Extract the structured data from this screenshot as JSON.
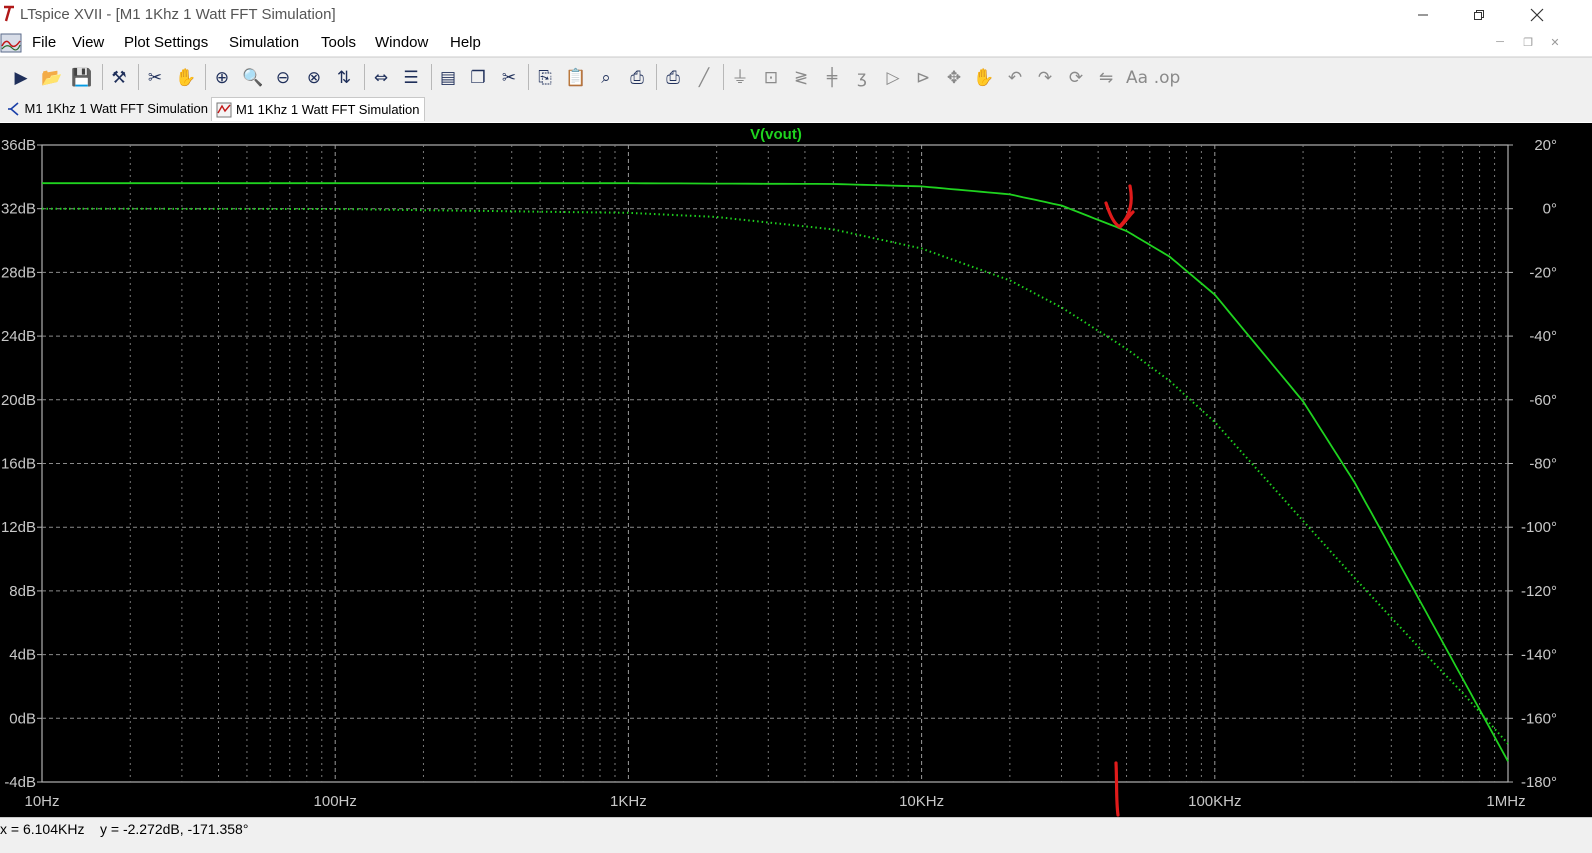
{
  "window": {
    "title": "LTspice XVII - [M1 1Khz 1 Watt FFT Simulation]",
    "icons": [
      "ltspice-app-icon",
      "minimize-icon",
      "maximize-icon",
      "close-icon"
    ]
  },
  "menu": {
    "items": [
      "File",
      "View",
      "Plot Settings",
      "Simulation",
      "Tools",
      "Window",
      "Help"
    ]
  },
  "toolbar": {
    "buttons": [
      "run",
      "open",
      "save",
      "control-panel",
      "run-halt",
      "pan",
      "zoom-area",
      "zoom-in",
      "zoom-out",
      "zoom-cancel",
      "autorange",
      "manual-limits",
      "tile-horizontal",
      "tile-vertical",
      "cascade",
      "cut",
      "copy",
      "paste",
      "find",
      "print-setup",
      "print",
      "wire",
      "ground",
      "label-net",
      "resistor",
      "capacitor",
      "inductor",
      "diode",
      "component",
      "move",
      "drag",
      "undo",
      "redo",
      "rotate",
      "mirror",
      "text",
      "spice-directive"
    ]
  },
  "tabs": [
    {
      "label": "M1 1Khz 1 Watt FFT Simulation",
      "icon": "schematic-icon",
      "active": false
    },
    {
      "label": "M1 1Khz 1 Watt FFT Simulation",
      "icon": "waveform-icon",
      "active": true
    }
  ],
  "chart_data": {
    "type": "line",
    "title": "V(vout)",
    "x_scale": "log",
    "x_range": [
      10,
      1000000
    ],
    "x_tick_labels": [
      "10Hz",
      "100Hz",
      "1KHz",
      "10KHz",
      "100KHz",
      "1MHz"
    ],
    "y_left_range": [
      -4,
      36
    ],
    "y_left_tick_labels": [
      "36dB",
      "32dB",
      "28dB",
      "24dB",
      "20dB",
      "16dB",
      "12dB",
      "8dB",
      "4dB",
      "0dB",
      "-4dB"
    ],
    "y_right_range": [
      -180,
      20
    ],
    "y_right_tick_labels": [
      "20°",
      "0°",
      "-20°",
      "-40°",
      "-60°",
      "-80°",
      "-100°",
      "-120°",
      "-140°",
      "-160°",
      "-180°"
    ],
    "grid": true,
    "background": "#000000",
    "trace_color": "#1fd31f",
    "annotation_color": "#e01b1b",
    "series": [
      {
        "axis": "left",
        "style": "solid",
        "x": [
          10,
          100,
          1000,
          5000,
          10000,
          20000,
          30000,
          50000,
          70000,
          100000,
          200000,
          300000,
          500000,
          700000,
          1000000
        ],
        "y": [
          33.6,
          33.6,
          33.6,
          33.55,
          33.4,
          32.9,
          32.2,
          30.6,
          29.0,
          26.6,
          19.9,
          14.8,
          7.4,
          2.5,
          -2.7
        ]
      },
      {
        "axis": "right",
        "style": "dotted",
        "x": [
          10,
          100,
          1000,
          2000,
          5000,
          10000,
          20000,
          30000,
          50000,
          70000,
          100000,
          200000,
          300000,
          500000,
          700000,
          1000000
        ],
        "y": [
          0,
          -0.1,
          -1.3,
          -2.6,
          -6.5,
          -12.5,
          -22.5,
          -31,
          -44,
          -54,
          -67,
          -98,
          -116,
          -138,
          -152,
          -168
        ]
      }
    ]
  },
  "status": {
    "text": "x = 6.104KHz    y = -2.272dB, -171.358°"
  }
}
